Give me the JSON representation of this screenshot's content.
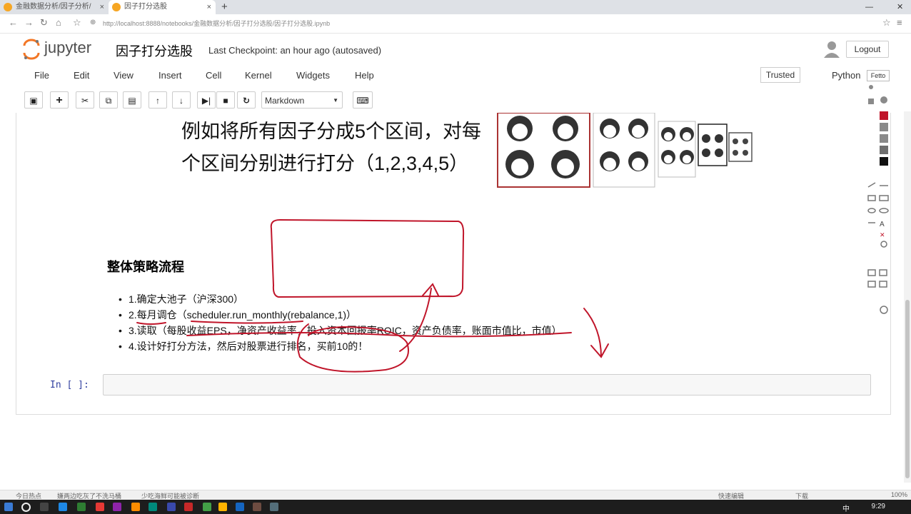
{
  "browser": {
    "tabs": [
      {
        "label": "金融数据分析/因子分析/"
      },
      {
        "label": "因子打分选股"
      }
    ],
    "new_tab": "+",
    "url": "http://localhost:8888/notebooks/金融数据分析/因子打分选股/因子打分选股.ipynb",
    "win_min": "—",
    "win_close": "✕"
  },
  "jupyter": {
    "logo_text": "jupyter",
    "notebook_title": "因子打分选股",
    "checkpoint": "Last Checkpoint: an hour ago (autosaved)",
    "logout": "Logout",
    "trusted": "Trusted",
    "kernel": "Python",
    "menu": [
      "File",
      "Edit",
      "View",
      "Insert",
      "Cell",
      "Kernel",
      "Widgets",
      "Help"
    ],
    "toolbar": {
      "buttons": [
        {
          "name": "save-icon",
          "glyph": "💾"
        },
        {
          "name": "insert-cell-icon",
          "glyph": "+"
        },
        {
          "name": "cut-icon",
          "glyph": "✂"
        },
        {
          "name": "copy-icon",
          "glyph": "⧉"
        },
        {
          "name": "paste-icon",
          "glyph": "📋"
        },
        {
          "name": "move-up-icon",
          "glyph": "↑"
        },
        {
          "name": "move-down-icon",
          "glyph": "↓"
        },
        {
          "name": "run-icon",
          "glyph": "⏭"
        },
        {
          "name": "stop-icon",
          "glyph": "■"
        },
        {
          "name": "restart-icon",
          "glyph": "↻"
        }
      ],
      "cell_type": "Markdown",
      "keyboard_glyph": "⌨"
    }
  },
  "content": {
    "big_line1": "例如将所有因子分成5个区间，对每",
    "big_line2": "个区间分别进行打分（1,2,3,4,5）",
    "heading": "整体策略流程",
    "steps": [
      "1.确定大池子（沪深300）",
      "2.每月调仓（scheduler.run_monthly(rebalance,1)）",
      "3.读取（每股收益EPS，净资产收益率，投入资本回报率ROIC，资产负债率，账面市值比，市值）",
      "4.设计好打分方法，然后对股票进行排名，买前10的！"
    ],
    "in_prompt": "In [ ]:"
  },
  "palette": {
    "label": "Fetto"
  },
  "statusbar": {
    "left": "今日热点",
    "mid1": "嫌两边吃灰了不洗马桶",
    "mid2": "少吃海鲜可能被诊断",
    "right1": "快速编辑",
    "right2": "下载",
    "zoom": "100%"
  },
  "taskbar": {
    "time": "9:29",
    "ime": "中"
  },
  "colors": {
    "annotation": "#c0152a",
    "prompt": "#303f9f"
  }
}
